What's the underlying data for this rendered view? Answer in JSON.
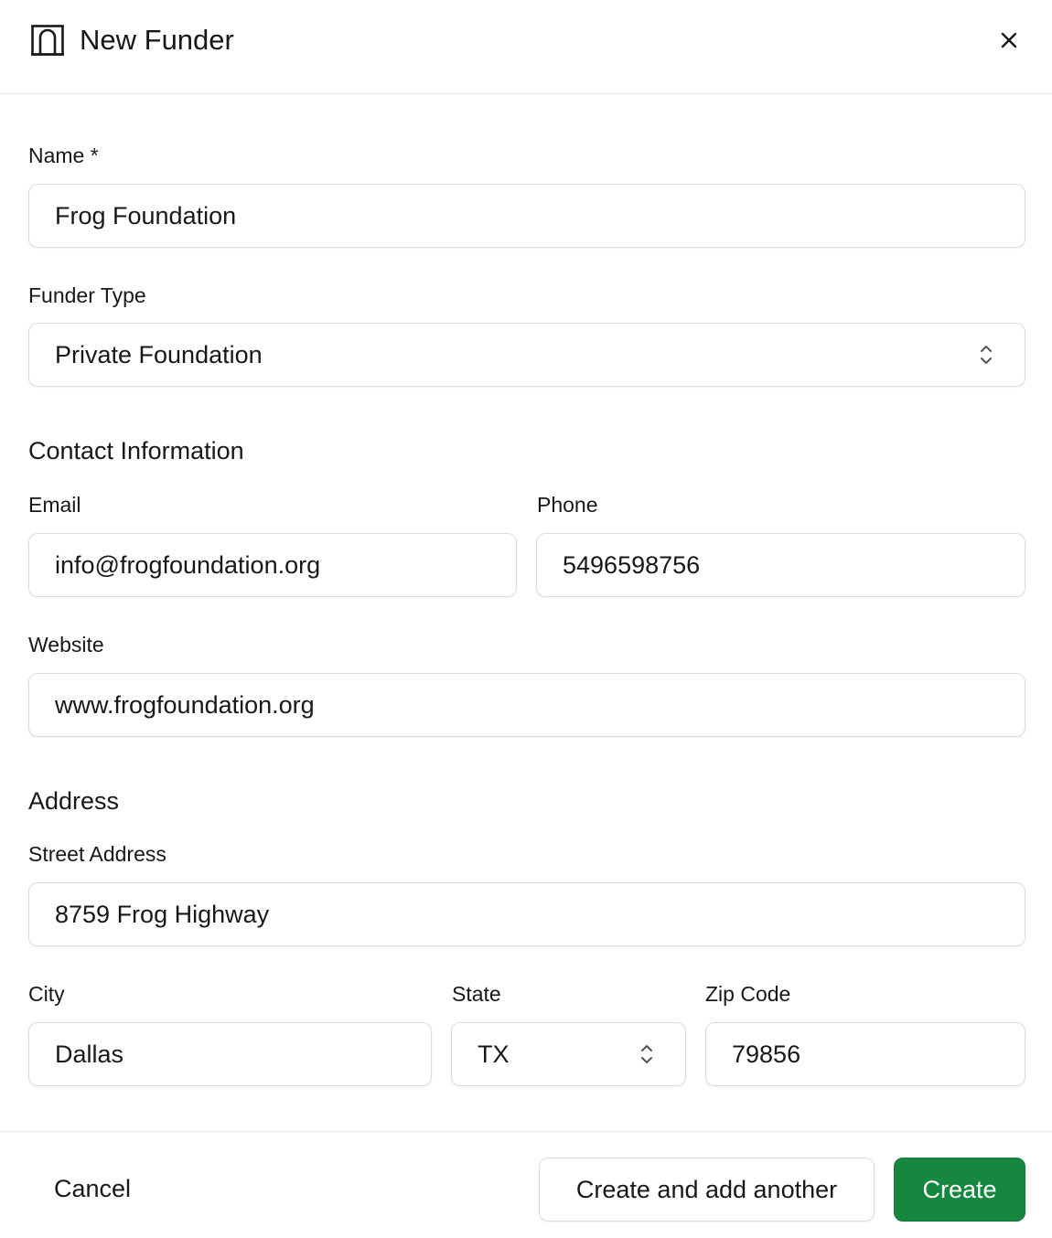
{
  "dialog": {
    "title": "New Funder",
    "title_icon": "building-icon",
    "close_icon": "close-icon"
  },
  "form": {
    "name": {
      "label": "Name *",
      "value": "Frog Foundation"
    },
    "funder_type": {
      "label": "Funder Type",
      "value": "Private Foundation",
      "icon": "chevron-up-down-icon"
    },
    "contact_section_title": "Contact Information",
    "email": {
      "label": "Email",
      "value": "info@frogfoundation.org"
    },
    "phone": {
      "label": "Phone",
      "value": "5496598756"
    },
    "website": {
      "label": "Website",
      "value": "www.frogfoundation.org"
    },
    "address_section_title": "Address",
    "street": {
      "label": "Street Address",
      "value": "8759 Frog Highway"
    },
    "city": {
      "label": "City",
      "value": "Dallas"
    },
    "state": {
      "label": "State",
      "value": "TX",
      "icon": "chevron-up-down-icon"
    },
    "zip": {
      "label": "Zip Code",
      "value": "79856"
    }
  },
  "footer": {
    "cancel_label": "Cancel",
    "create_another_label": "Create and add another",
    "create_label": "Create"
  },
  "colors": {
    "primary": "#16873f",
    "border": "#dcdce0",
    "text": "#18181b"
  }
}
